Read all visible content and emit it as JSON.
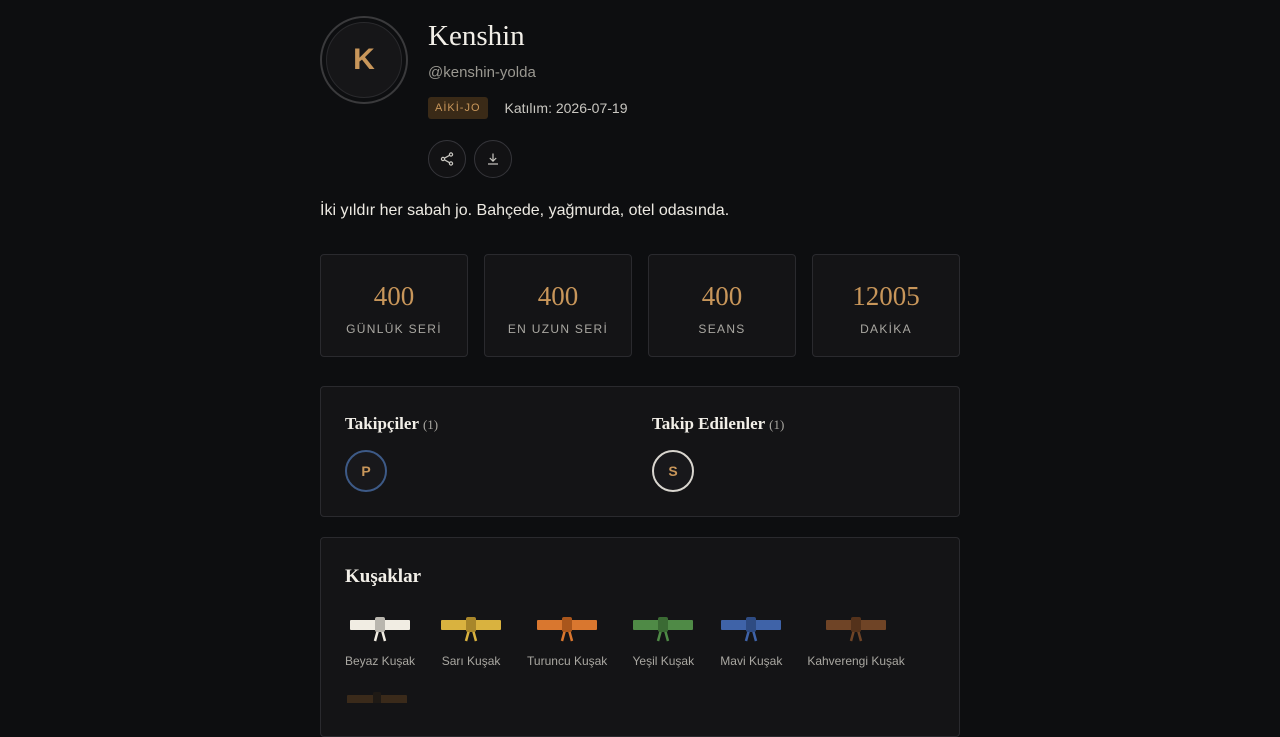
{
  "profile": {
    "avatar_initial": "K",
    "name": "Kenshin",
    "handle": "@kenshin-yolda",
    "style_tag": "AİKİ-JO",
    "joined": "Katılım: 2026-07-19",
    "bio": "İki yıldır her sabah jo. Bahçede, yağmurda, otel odasında."
  },
  "actions": {
    "share_icon": "share-icon",
    "download_icon": "download-icon"
  },
  "stats": [
    {
      "value": "400",
      "label": "GÜNLÜK SERİ"
    },
    {
      "value": "400",
      "label": "EN UZUN SERİ"
    },
    {
      "value": "400",
      "label": "SEANS"
    },
    {
      "value": "12005",
      "label": "DAKİKA"
    }
  ],
  "follows": {
    "followers": {
      "title": "Takipçiler",
      "count": "(1)",
      "initial": "P"
    },
    "following": {
      "title": "Takip Edilenler",
      "count": "(1)",
      "initial": "S"
    }
  },
  "belts": {
    "title": "Kuşaklar",
    "items": [
      {
        "label": "Beyaz Kuşak",
        "color": "#f1ede3",
        "knot": "#b9b6ae"
      },
      {
        "label": "Sarı Kuşak",
        "color": "#d9b23f",
        "knot": "#a8862a"
      },
      {
        "label": "Turuncu Kuşak",
        "color": "#d9772f",
        "knot": "#a9561c"
      },
      {
        "label": "Yeşil Kuşak",
        "color": "#4f8a46",
        "knot": "#3a6a33"
      },
      {
        "label": "Mavi Kuşak",
        "color": "#3f63a8",
        "knot": "#2e4b82"
      },
      {
        "label": "Kahverengi Kuşak",
        "color": "#6f4426",
        "knot": "#54321b"
      }
    ]
  },
  "colors": {
    "background": "#0d0e10",
    "accent": "#c8965a",
    "card": "#141416"
  }
}
